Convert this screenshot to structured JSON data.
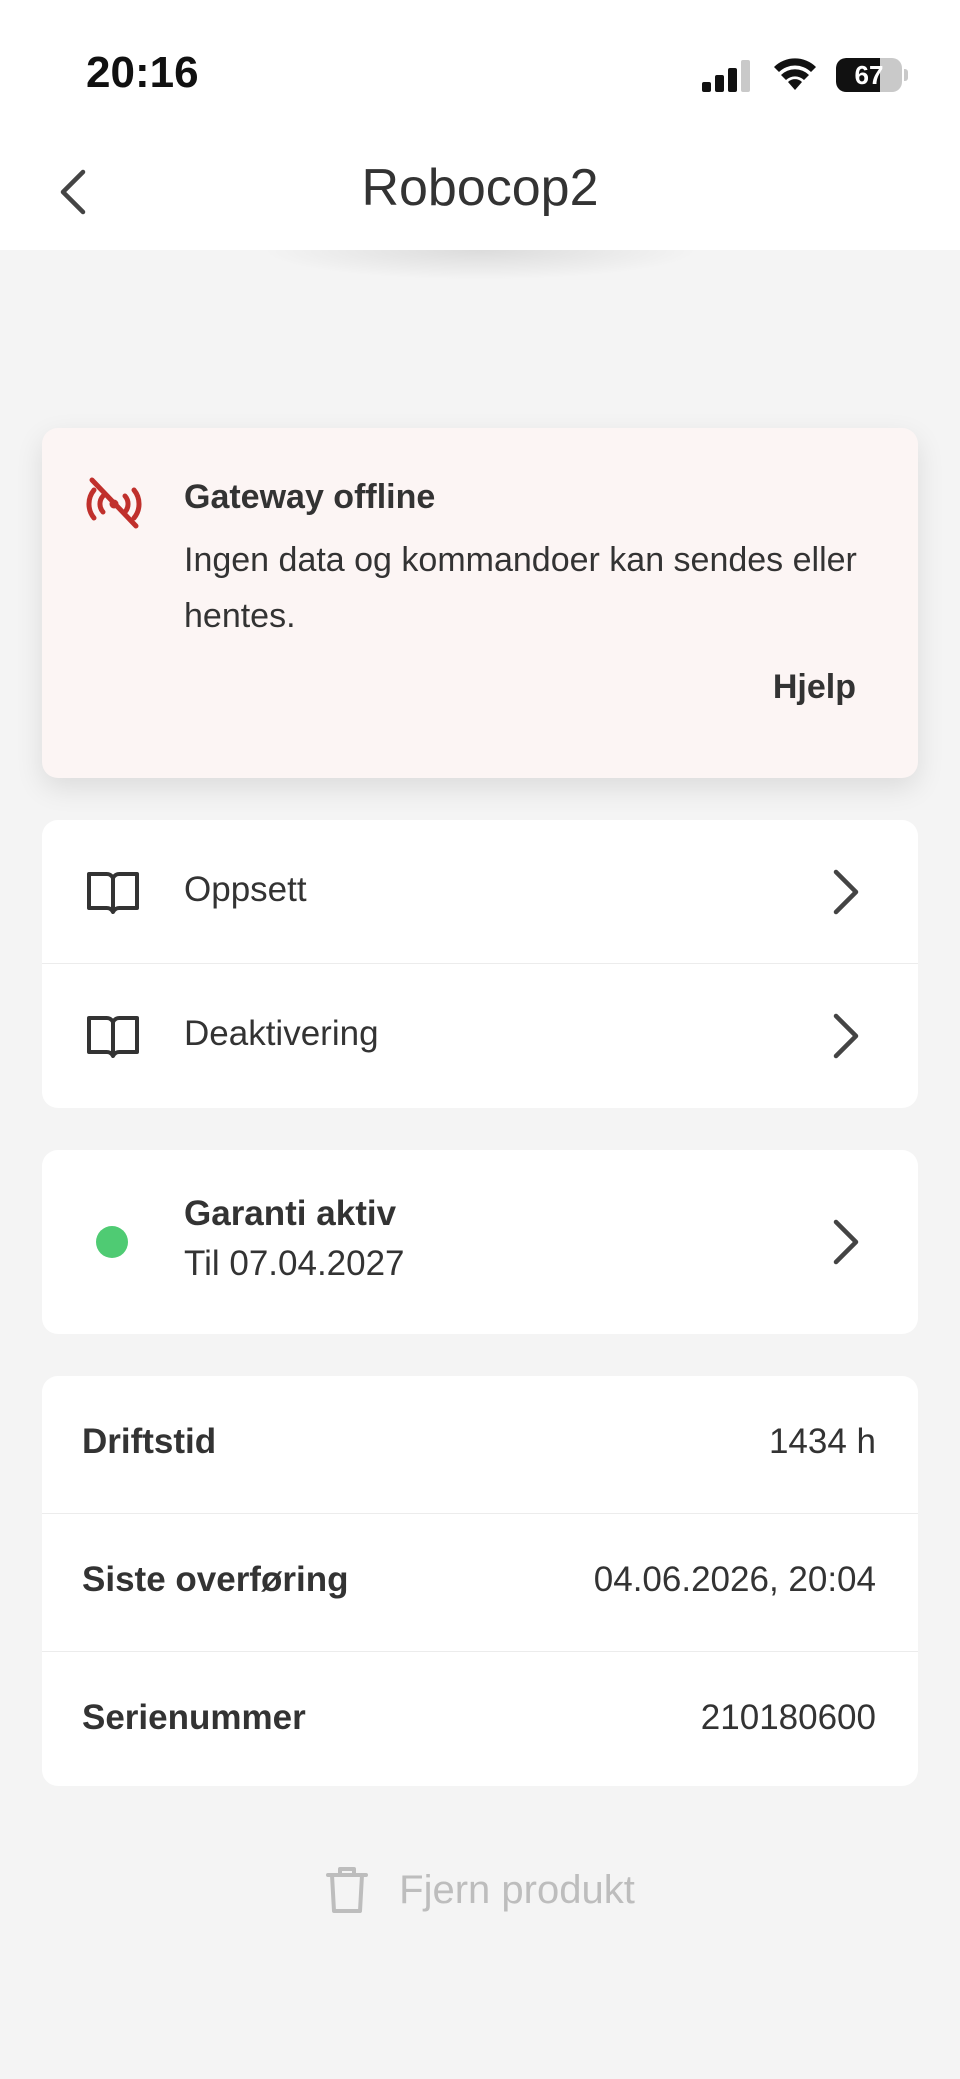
{
  "status_bar": {
    "time": "20:16",
    "battery_level": "67",
    "battery_fraction": 0.67
  },
  "header": {
    "title": "Robocop2",
    "back_icon": "chevron-left-icon"
  },
  "alert": {
    "icon": "wifi-off-icon",
    "icon_color": "#c0302c",
    "title": "Gateway offline",
    "message": "Ingen data og kommandoer kan sendes eller hentes.",
    "action_label": "Hjelp"
  },
  "docs": {
    "items": [
      {
        "label": "Oppsett",
        "icon": "book-icon"
      },
      {
        "label": "Deaktivering",
        "icon": "book-icon"
      }
    ]
  },
  "warranty": {
    "title": "Garanti aktiv",
    "subtitle": "Til 07.04.2027",
    "status_color": "#4fcb73"
  },
  "info": {
    "rows": [
      {
        "label": "Driftstid",
        "value": "1434 h"
      },
      {
        "label": "Siste overføring",
        "value": "04.06.2026, 20:04"
      },
      {
        "label": "Serienummer",
        "value": "210180600"
      }
    ]
  },
  "footer": {
    "remove_label": "Fjern produkt",
    "remove_icon": "trash-icon"
  }
}
